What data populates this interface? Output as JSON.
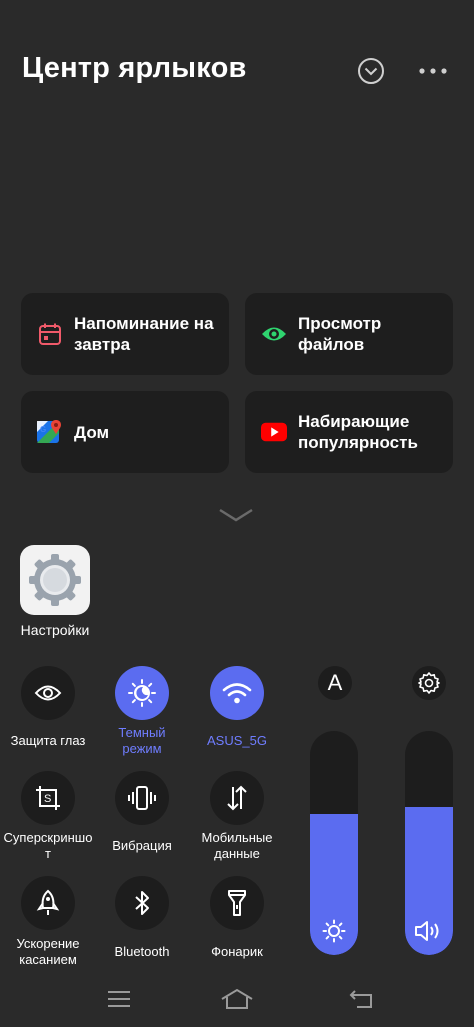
{
  "header": {
    "title": "Центр ярлыков",
    "collapse_icon": "chevron-circle-icon",
    "more_icon": "more-dots-icon"
  },
  "shortcuts": [
    {
      "label": "Напоминание на\nзавтра",
      "icon": "calendar-icon"
    },
    {
      "label": "Просмотр\nфайлов",
      "icon": "eye-icon"
    },
    {
      "label": "Дом",
      "icon": "maps-icon"
    },
    {
      "label": "Набирающие\nпопулярность",
      "icon": "youtube-icon"
    }
  ],
  "expand_icon": "chevron-down-icon",
  "app": {
    "label": "Настройки",
    "icon": "gear-icon"
  },
  "toggles": [
    {
      "label": "Защита глаз",
      "icon": "eye-icon",
      "on": false
    },
    {
      "label": "Темный\nрежим",
      "icon": "dark-mode-icon",
      "on": true
    },
    {
      "label": "ASUS_5G",
      "icon": "wifi-icon",
      "on": true
    },
    {
      "label": "Суперскриншо\nт",
      "icon": "screenshot-icon",
      "on": false
    },
    {
      "label": "Вибрация",
      "icon": "vibration-icon",
      "on": false
    },
    {
      "label": "Мобильные\nданные",
      "icon": "mobile-data-icon",
      "on": false
    },
    {
      "label": "Ускорение\nкасанием",
      "icon": "rocket-icon",
      "on": false
    },
    {
      "label": "Bluetooth",
      "icon": "bluetooth-icon",
      "on": false
    },
    {
      "label": "Фонарик",
      "icon": "flashlight-icon",
      "on": false
    }
  ],
  "sliders": {
    "auto_brightness_label": "A",
    "settings_icon": "gear-icon",
    "brightness_level": 0.63,
    "volume_level": 0.66
  },
  "colors": {
    "accent": "#5b6cf0",
    "background": "#2a2a2a",
    "card": "#1e1e1e"
  }
}
